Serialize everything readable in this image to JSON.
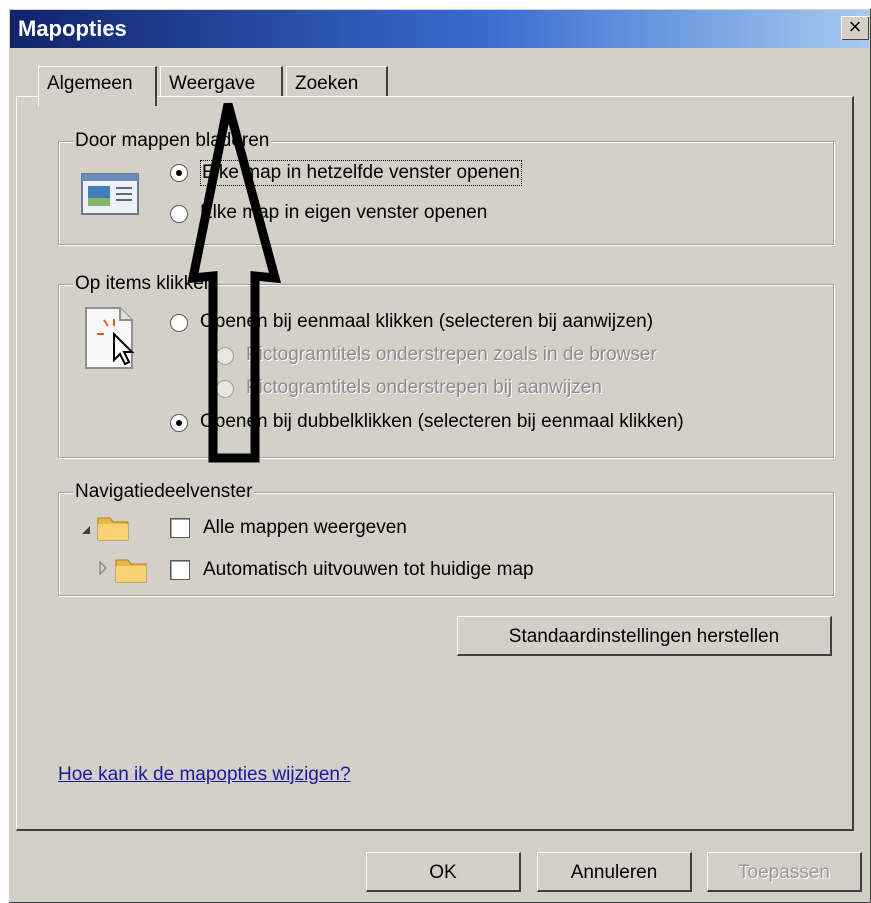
{
  "window": {
    "title": "Mapopties",
    "close_label": "×"
  },
  "tabs": [
    {
      "label": "Algemeen",
      "active": true
    },
    {
      "label": "Weergave",
      "active": false
    },
    {
      "label": "Zoeken",
      "active": false
    }
  ],
  "browse_folders": {
    "label": "Door mappen bladeren",
    "options": [
      {
        "label": "Elke map in hetzelfde venster openen",
        "checked": true
      },
      {
        "label": "Elke map in eigen venster openen",
        "checked": false
      }
    ]
  },
  "click_items": {
    "label": "Op items klikken",
    "options": [
      {
        "label": "Openen bij eenmaal klikken (selecteren bij aanwijzen)",
        "checked": false,
        "disabled": false
      },
      {
        "label": "Pictogramtitels onderstrepen zoals in de browser",
        "checked": false,
        "disabled": true
      },
      {
        "label": "Pictogramtitels onderstrepen bij aanwijzen",
        "checked": false,
        "disabled": true
      },
      {
        "label": "Openen bij dubbelklikken (selecteren bij eenmaal klikken)",
        "checked": true,
        "disabled": false
      }
    ]
  },
  "navigation_pane": {
    "label": "Navigatiedeelvenster",
    "options": [
      {
        "label": "Alle mappen weergeven",
        "checked": false
      },
      {
        "label": "Automatisch uitvouwen tot huidige map",
        "checked": false
      }
    ]
  },
  "restore_defaults_label": "Standaardinstellingen herstellen",
  "help_link": "Hoe kan ik de mapopties wijzigen?",
  "buttons": {
    "ok": "OK",
    "cancel": "Annuleren",
    "apply": "Toepassen"
  },
  "icons": [
    "window-icon",
    "pointer-click-icon",
    "folder-expanded-icon",
    "folder-collapsed-icon",
    "up-arrow-annotation"
  ]
}
